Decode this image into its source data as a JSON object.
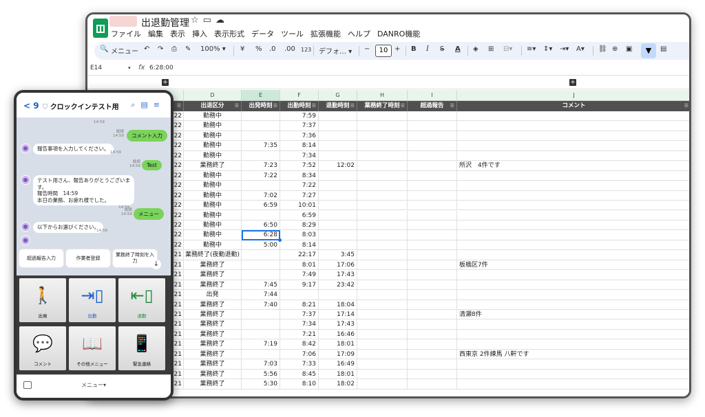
{
  "sheet": {
    "title": "出退勤管理",
    "menu": [
      "ファイル",
      "編集",
      "表示",
      "挿入",
      "表示形式",
      "データ",
      "ツール",
      "拡張機能",
      "ヘルプ",
      "DANRO機能"
    ],
    "toolbar": {
      "search": "メニュー",
      "zoom": "100%",
      "currency": "¥",
      "percent": "%",
      "dec_minus": ".0",
      "dec_plus": ".00",
      "num": "123",
      "font": "デフォ…",
      "font_size": "10",
      "minus": "−",
      "plus": "+",
      "bold": "B",
      "italic": "I",
      "strike": "S",
      "textcolor": "A"
    },
    "name_box": "E14",
    "fx": "fx",
    "formula_value": "6:28:00",
    "col_letters": [
      "D",
      "E",
      "F",
      "G",
      "H",
      "I",
      "J"
    ],
    "headers": [
      "出退区分",
      "出発時刻",
      "出勤時刻",
      "退勤時刻",
      "業務終了時刻",
      "超過報告",
      "コメント"
    ],
    "rows": [
      {
        "date": "/22",
        "d": "勤務中",
        "e": "",
        "f": "7:59",
        "g": "",
        "j": ""
      },
      {
        "date": "/22",
        "d": "勤務中",
        "e": "",
        "f": "7:37",
        "g": "",
        "j": ""
      },
      {
        "date": "/22",
        "d": "勤務中",
        "e": "",
        "f": "7:36",
        "g": "",
        "j": ""
      },
      {
        "date": "/22",
        "d": "勤務中",
        "e": "7:35",
        "f": "8:14",
        "g": "",
        "j": ""
      },
      {
        "date": "/22",
        "d": "勤務中",
        "e": "",
        "f": "7:34",
        "g": "",
        "j": ""
      },
      {
        "date": "/22",
        "d": "業務終了",
        "e": "7:23",
        "f": "7:52",
        "g": "12:02",
        "j": "所沢　4件です"
      },
      {
        "date": "/22",
        "d": "勤務中",
        "e": "7:22",
        "f": "8:34",
        "g": "",
        "j": ""
      },
      {
        "date": "/22",
        "d": "勤務中",
        "e": "",
        "f": "7:22",
        "g": "",
        "j": ""
      },
      {
        "date": "/22",
        "d": "勤務中",
        "e": "7:02",
        "f": "7:27",
        "g": "",
        "j": ""
      },
      {
        "date": "/22",
        "d": "勤務中",
        "e": "6:59",
        "f": "10:01",
        "g": "",
        "j": ""
      },
      {
        "date": "/22",
        "d": "勤務中",
        "e": "",
        "f": "6:59",
        "g": "",
        "j": ""
      },
      {
        "date": "/22",
        "d": "勤務中",
        "e": "6:50",
        "f": "8:29",
        "g": "",
        "j": ""
      },
      {
        "date": "/22",
        "d": "勤務中",
        "e": "6:28",
        "f": "8:03",
        "g": "",
        "j": ""
      },
      {
        "date": "/22",
        "d": "勤務中",
        "e": "5:00",
        "f": "8:14",
        "g": "",
        "j": ""
      },
      {
        "date": "/21",
        "d": "業務終了(夜勤退勤)",
        "e": "",
        "f": "22:17",
        "g": "3:45",
        "j": ""
      },
      {
        "date": "/21",
        "d": "業務終了",
        "e": "",
        "f": "8:01",
        "g": "17:06",
        "j": "板橋区7件"
      },
      {
        "date": "/21",
        "d": "業務終了",
        "e": "",
        "f": "7:49",
        "g": "17:43",
        "j": ""
      },
      {
        "date": "/21",
        "d": "業務終了",
        "e": "7:45",
        "f": "9:17",
        "g": "23:42",
        "j": ""
      },
      {
        "date": "/21",
        "d": "出発",
        "e": "7:44",
        "f": "",
        "g": "",
        "j": ""
      },
      {
        "date": "/21",
        "d": "業務終了",
        "e": "7:40",
        "f": "8:21",
        "g": "18:04",
        "j": ""
      },
      {
        "date": "/21",
        "d": "業務終了",
        "e": "",
        "f": "7:37",
        "g": "17:14",
        "j": "清瀬8件"
      },
      {
        "date": "/21",
        "d": "業務終了",
        "e": "",
        "f": "7:34",
        "g": "17:43",
        "j": ""
      },
      {
        "date": "/21",
        "d": "業務終了",
        "e": "",
        "f": "7:21",
        "g": "16:46",
        "j": ""
      },
      {
        "date": "/21",
        "d": "業務終了",
        "e": "7:19",
        "f": "8:42",
        "g": "18:01",
        "j": ""
      },
      {
        "date": "/21",
        "d": "業務終了",
        "e": "",
        "f": "7:06",
        "g": "17:09",
        "j": "西東京 2件練馬 八軒です"
      },
      {
        "date": "/21",
        "d": "業務終了",
        "e": "7:03",
        "f": "7:33",
        "g": "16:49",
        "j": ""
      },
      {
        "date": "/21",
        "d": "業務終了",
        "e": "5:56",
        "f": "8:45",
        "g": "18:01",
        "j": ""
      },
      {
        "date": "/21",
        "d": "業務終了",
        "e": "5:30",
        "f": "8:10",
        "g": "18:02",
        "j": ""
      }
    ]
  },
  "phone": {
    "back": "< 9",
    "title": "クロックインテスト用",
    "chat": {
      "m1_meta": "14:59",
      "m2": "コメント入力",
      "m2_read": "既読",
      "m2_time": "14:59",
      "m3": "報告事項を入力してください。",
      "m3_time": "14:59",
      "m4": "Test",
      "m4_read": "既読",
      "m4_time": "14:59",
      "m5_l1": "テスト用さん、報告ありがとうございま",
      "m5_l2": "す。",
      "m5_l3": "報告時間　14:59",
      "m5_l4": "本日の業務、お疲れ様でした。",
      "m5_time": "14:59",
      "m6": "メニュー",
      "m6_read": "既読",
      "m6_time": "14:59",
      "m7": "以下からお選びください。",
      "m7_time": "14:59"
    },
    "quick_replies": [
      "超過報告入力",
      "作業者登録",
      "業務終了時刻を入力"
    ],
    "menu_tiles": [
      "出発",
      "出勤",
      "退勤",
      "コメント",
      "その他メニュー",
      "緊急連絡"
    ],
    "footer": "メニュー▾"
  }
}
